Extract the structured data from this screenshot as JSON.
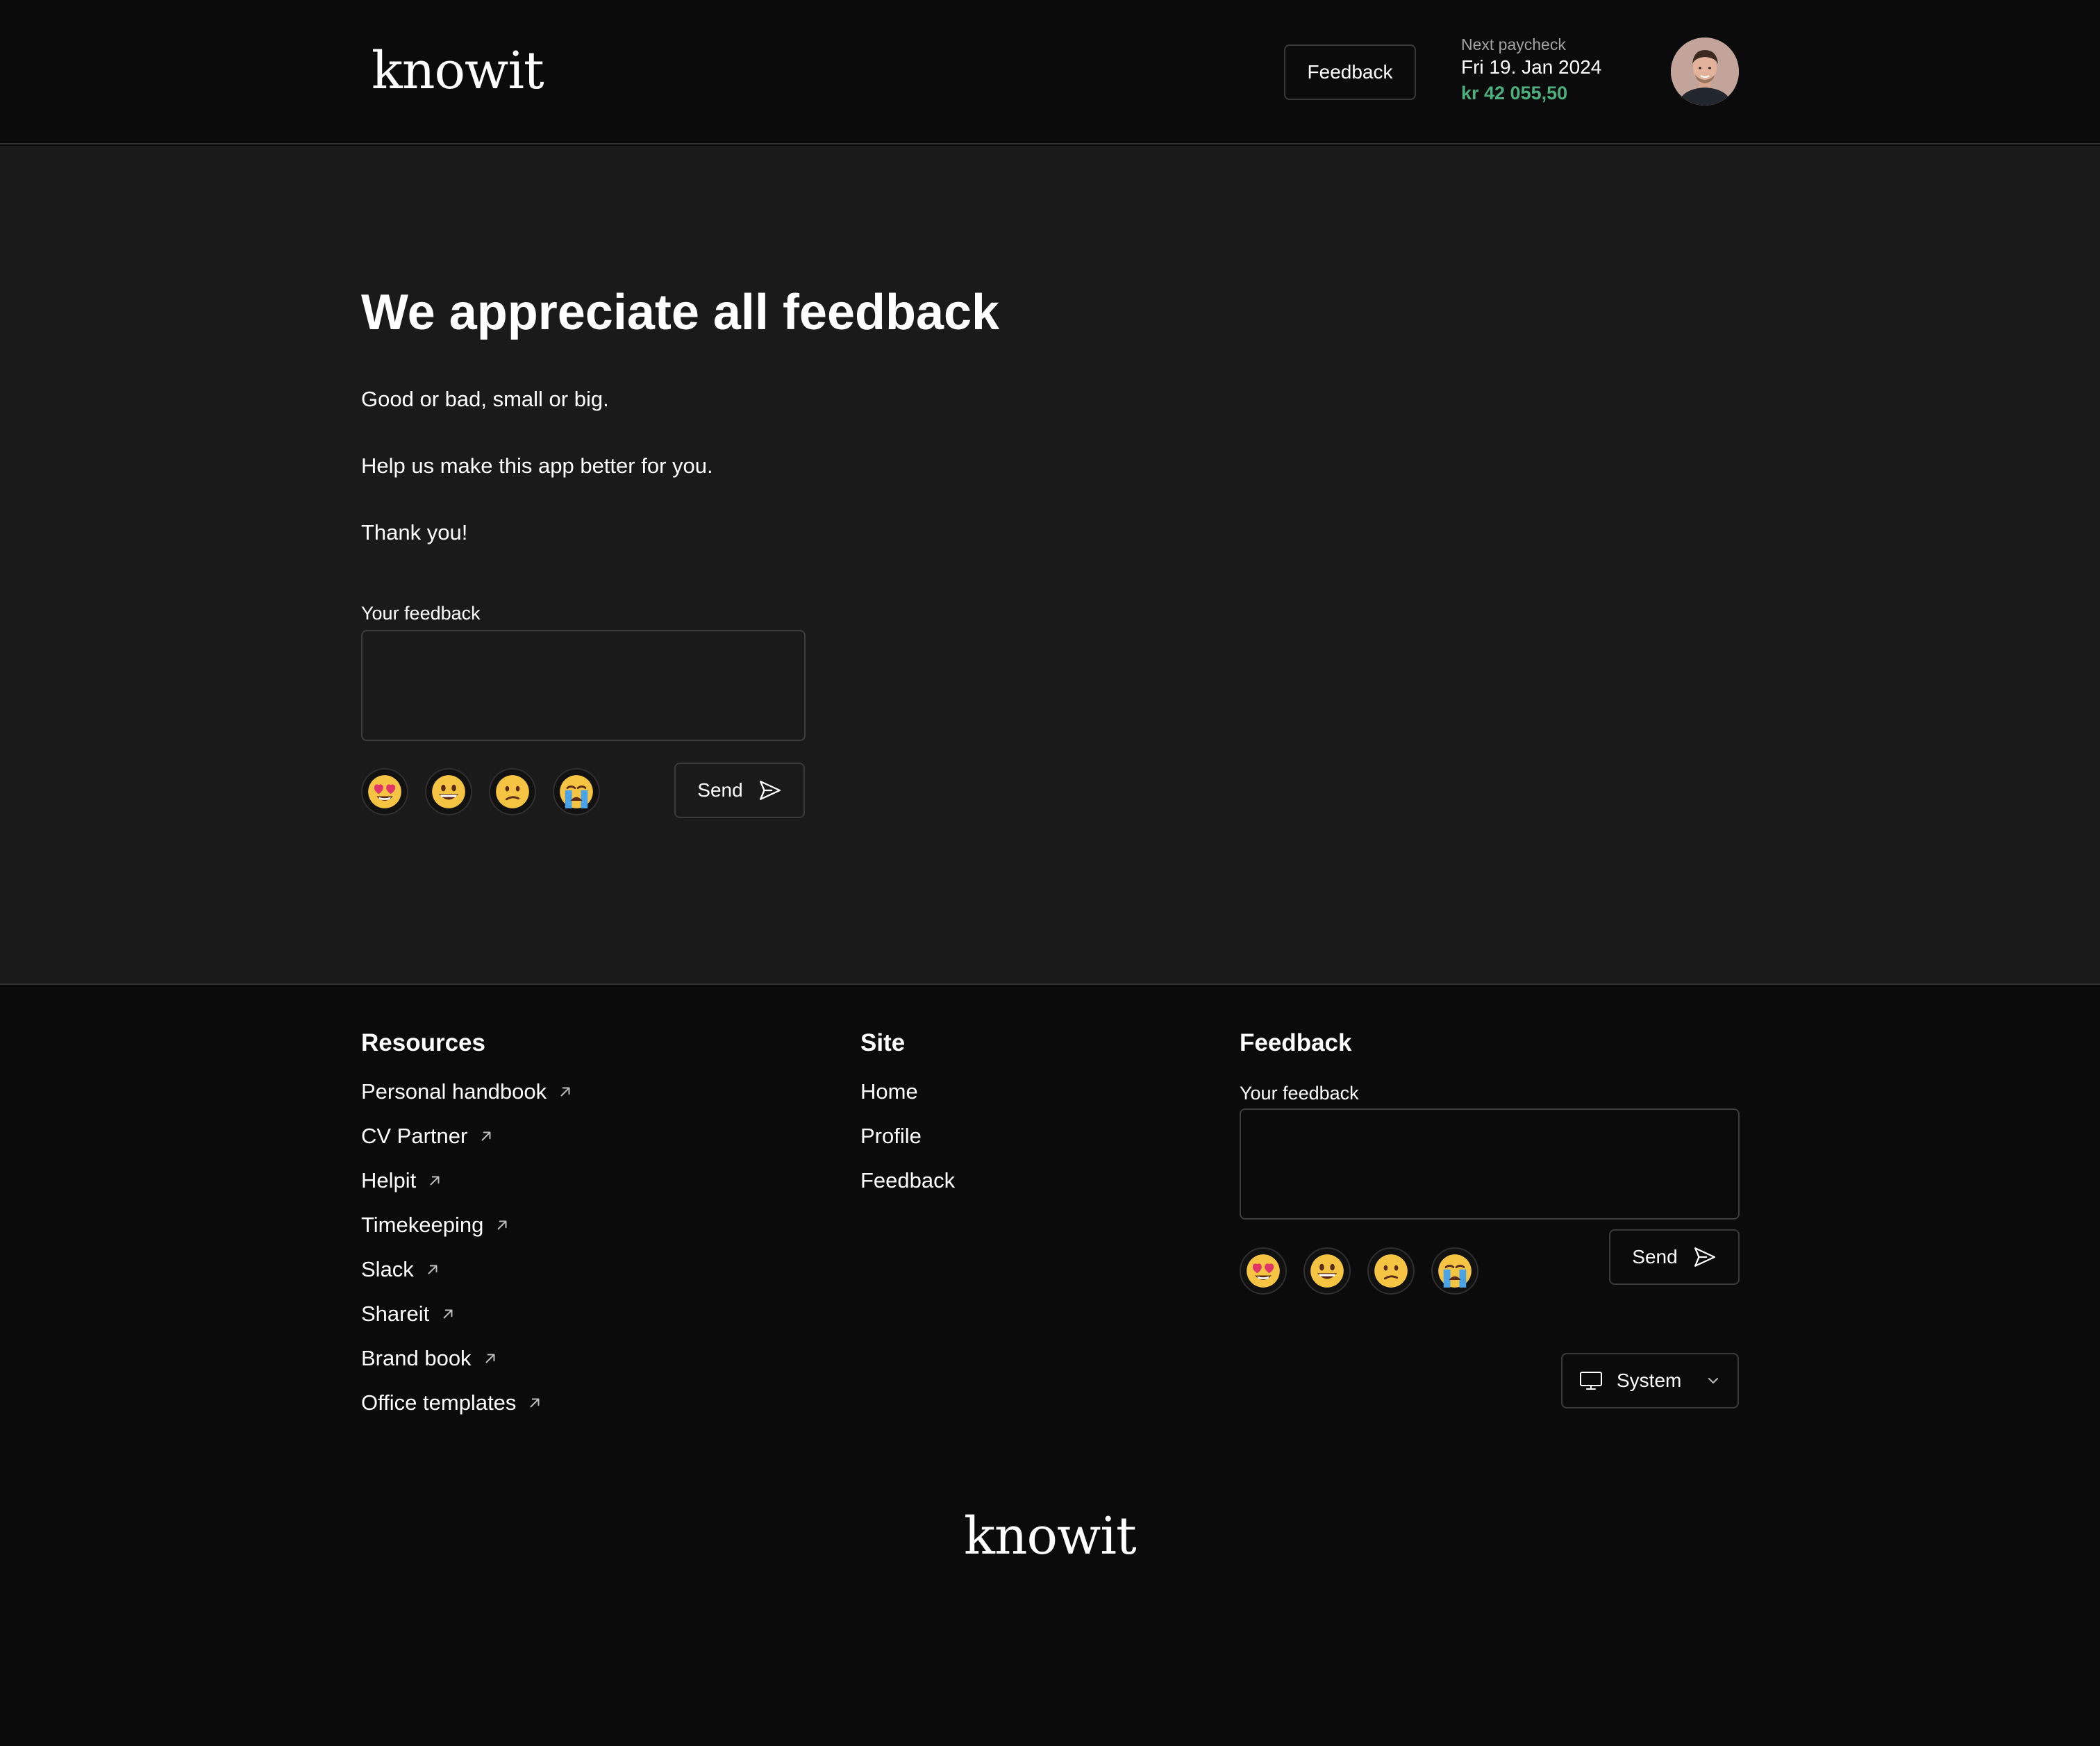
{
  "header": {
    "logo_text": "knowit",
    "feedback_button": "Feedback",
    "paycheck_label": "Next paycheck",
    "paycheck_date": "Fri 19. Jan 2024",
    "paycheck_amount": "kr 42 055,50",
    "amount_color": "#4fae7e"
  },
  "main": {
    "title": "We appreciate all feedback",
    "intro_lines": [
      "Good or bad, small or big.",
      "Help us make this app better for you.",
      "Thank you!"
    ],
    "feedback_label": "Your feedback",
    "feedback_value": "",
    "emojis": [
      "heart-eyes-emoji-icon",
      "grinning-face-emoji-icon",
      "confused-face-emoji-icon",
      "crying-face-emoji-icon"
    ],
    "send_label": "Send"
  },
  "footer": {
    "resources": {
      "heading": "Resources",
      "links": [
        "Personal handbook",
        "CV Partner",
        "Helpit",
        "Timekeeping",
        "Slack",
        "Shareit",
        "Brand book",
        "Office templates"
      ]
    },
    "site": {
      "heading": "Site",
      "links": [
        "Home",
        "Profile",
        "Feedback"
      ]
    },
    "feedback": {
      "heading": "Feedback",
      "label": "Your feedback",
      "value": "",
      "send_label": "Send"
    },
    "theme_select": {
      "selected": "System"
    },
    "logo_text": "knowit"
  },
  "colors": {
    "background": "#0b0b0b",
    "main_background": "#1a1a1a",
    "accent_green": "#4fae7e"
  }
}
